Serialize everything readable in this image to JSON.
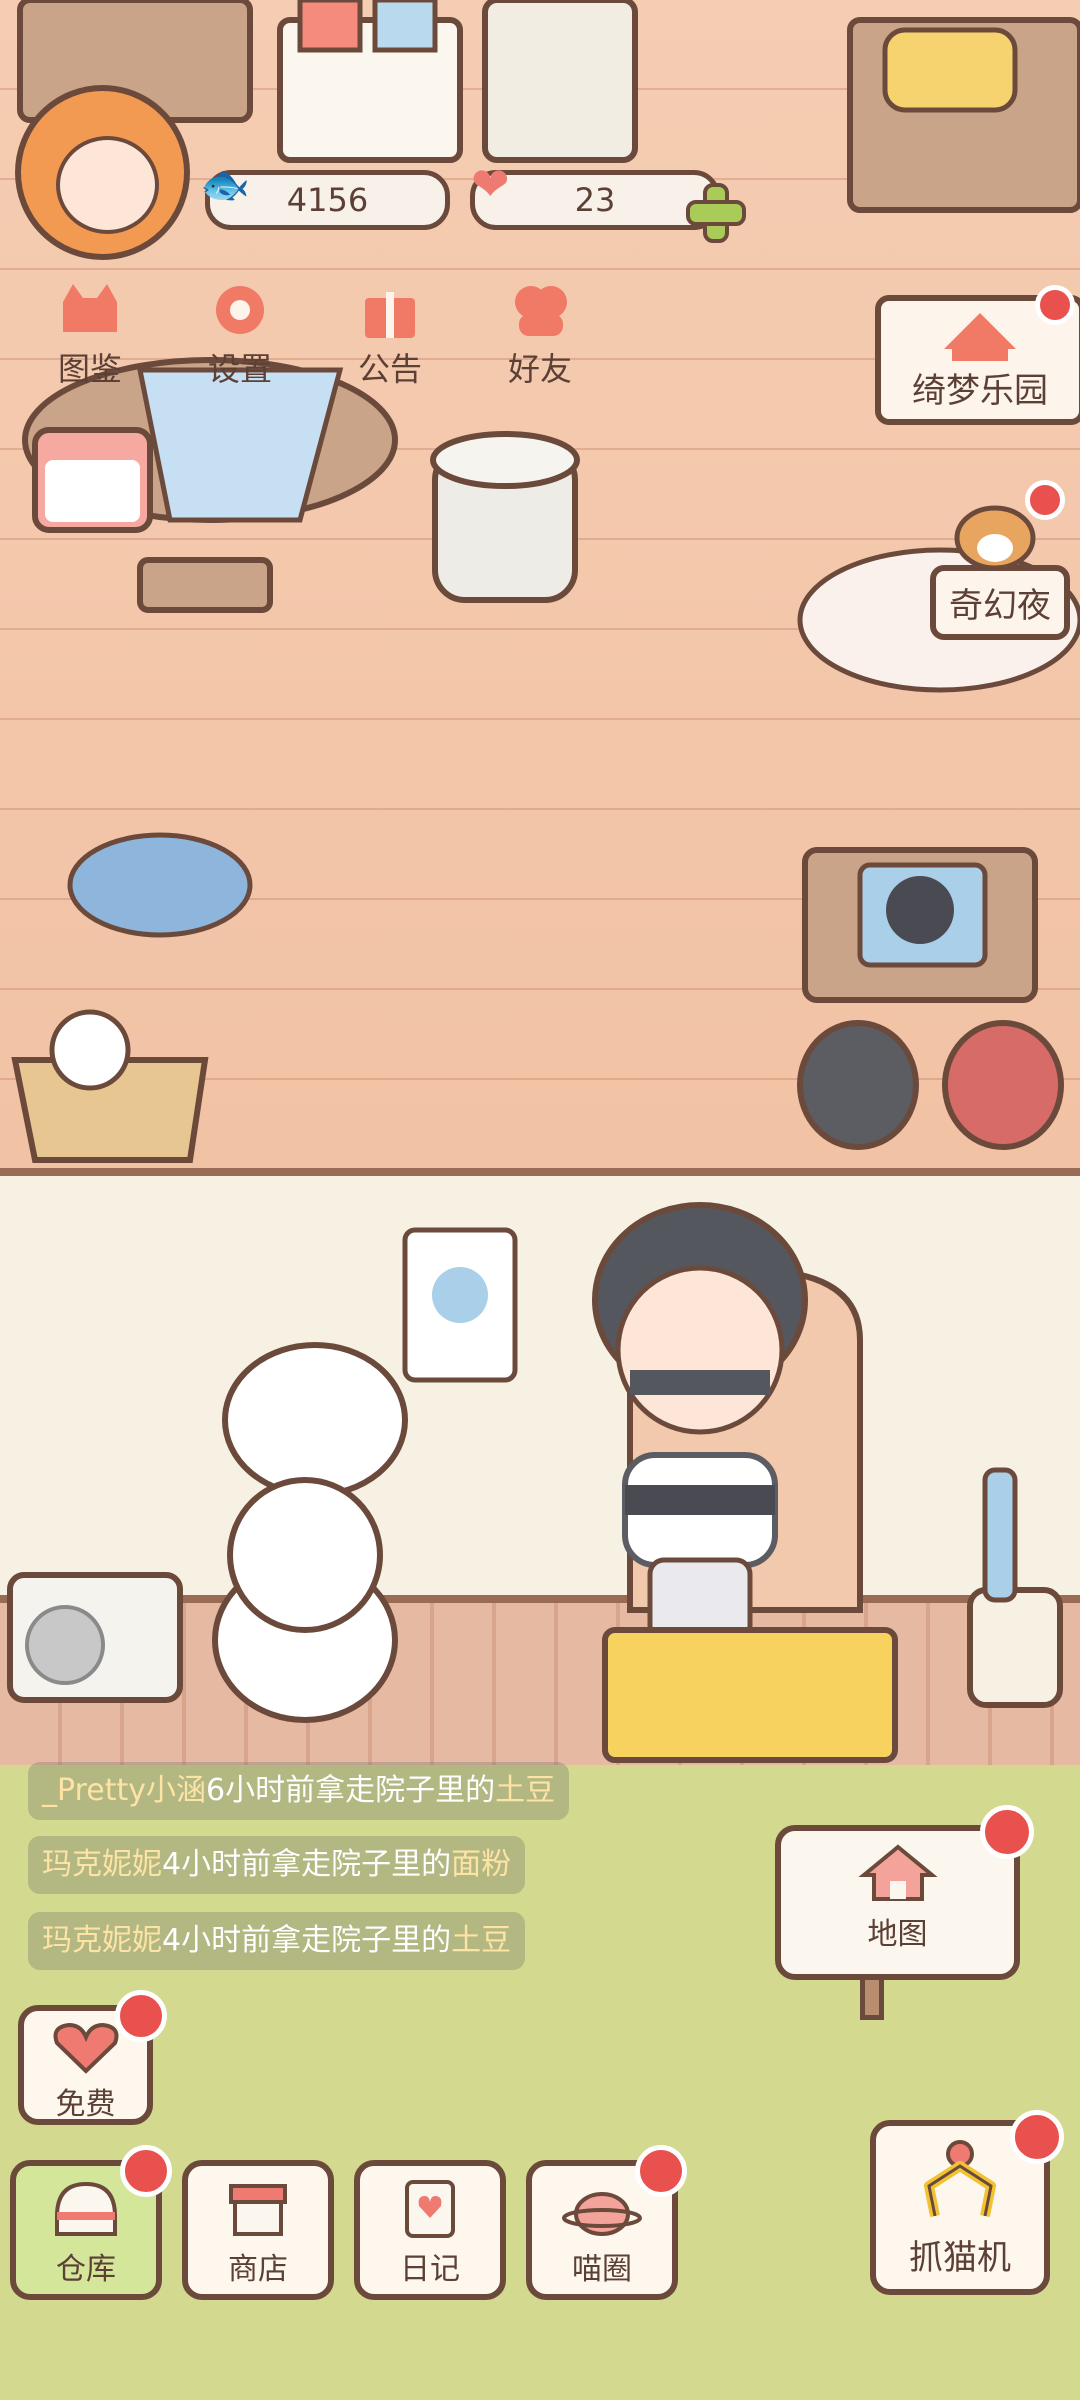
{
  "hud": {
    "fish_count": "4156",
    "heart_count": "23"
  },
  "menu": [
    {
      "label": "图鉴",
      "icon": "cat-book-icon"
    },
    {
      "label": "设置",
      "icon": "gear-icon"
    },
    {
      "label": "公告",
      "icon": "gift-icon"
    },
    {
      "label": "好友",
      "icon": "friends-icon"
    }
  ],
  "events": [
    {
      "label": "绮梦乐园",
      "icon": "circus-tent-icon"
    },
    {
      "label": "奇幻夜",
      "icon": "dog-icon"
    }
  ],
  "feed": [
    {
      "user": "_Pretty小涵",
      "mid": "6小时前拿走院子里的",
      "item": "土豆"
    },
    {
      "user": "玛克妮妮",
      "mid": "4小时前拿走院子里的",
      "item": "面粉"
    },
    {
      "user": "玛克妮妮",
      "mid": "4小时前拿走院子里的",
      "item": "土豆"
    }
  ],
  "map_label": "地图",
  "free_label": "免费",
  "bottom_nav": [
    {
      "label": "仓库",
      "icon": "warehouse-icon"
    },
    {
      "label": "商店",
      "icon": "shop-icon"
    },
    {
      "label": "日记",
      "icon": "diary-icon"
    },
    {
      "label": "喵圈",
      "icon": "planet-cat-icon"
    }
  ],
  "claw_label": "抓猫机",
  "colors": {
    "accent_red": "#e8514d",
    "outline_brown": "#6b4a3c",
    "wall_brick": "#f3c9ad",
    "lawn": "#d3d98e"
  }
}
